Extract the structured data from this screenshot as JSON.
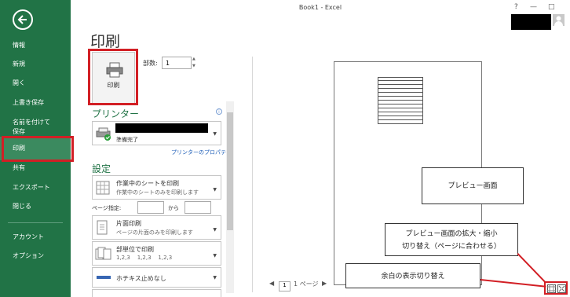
{
  "window": {
    "title": "Book1 - Excel",
    "help": "?",
    "minimize": "—",
    "maximize": "□"
  },
  "sidebar": {
    "items": [
      {
        "label": "情報",
        "name": "sidebar-item-info"
      },
      {
        "label": "新規",
        "name": "sidebar-item-new"
      },
      {
        "label": "開く",
        "name": "sidebar-item-open"
      },
      {
        "label": "上書き保存",
        "name": "sidebar-item-save"
      },
      {
        "label": "名前を付けて",
        "name": "sidebar-item-saveas-1"
      },
      {
        "label": "保存",
        "name": "sidebar-item-saveas-2"
      },
      {
        "label": "印刷",
        "name": "sidebar-item-print",
        "active": true
      },
      {
        "label": "共有",
        "name": "sidebar-item-share"
      },
      {
        "label": "エクスポート",
        "name": "sidebar-item-export"
      },
      {
        "label": "閉じる",
        "name": "sidebar-item-close"
      },
      {
        "label": "アカウント",
        "name": "sidebar-item-account"
      },
      {
        "label": "オプション",
        "name": "sidebar-item-options"
      }
    ]
  },
  "page": {
    "title": "印刷"
  },
  "print": {
    "button_label": "印刷",
    "copies_label": "部数:",
    "copies_value": "1"
  },
  "printer": {
    "heading": "プリンター",
    "status": "準備完了",
    "properties_link": "プリンターのプロパティ"
  },
  "settings": {
    "heading": "設定",
    "sheets": {
      "main": "作業中のシートを印刷",
      "sub": "作業中のシートのみを印刷します"
    },
    "pages_label": "ページ指定:",
    "to_label": "から",
    "sides": {
      "main": "片面印刷",
      "sub": "ページの片面のみを印刷します"
    },
    "collate": {
      "main": "部単位で印刷",
      "sub": "1,2,3    1,2,3    1,2,3"
    },
    "staple": {
      "main": "ホチキス止めなし"
    }
  },
  "preview": {
    "page_value": "1",
    "page_suffix": "1 ページ",
    "callouts": {
      "preview": "プレビュー画面",
      "zoom_line1": "プレビュー画面の拡大・縮小",
      "zoom_line2": "切り替え（ページに合わせる）",
      "margins": "余白の表示切り替え"
    }
  },
  "colors": {
    "sidebar": "#217346",
    "accent": "#217346",
    "annotation": "#d21f25",
    "link": "#1f5fb8"
  }
}
